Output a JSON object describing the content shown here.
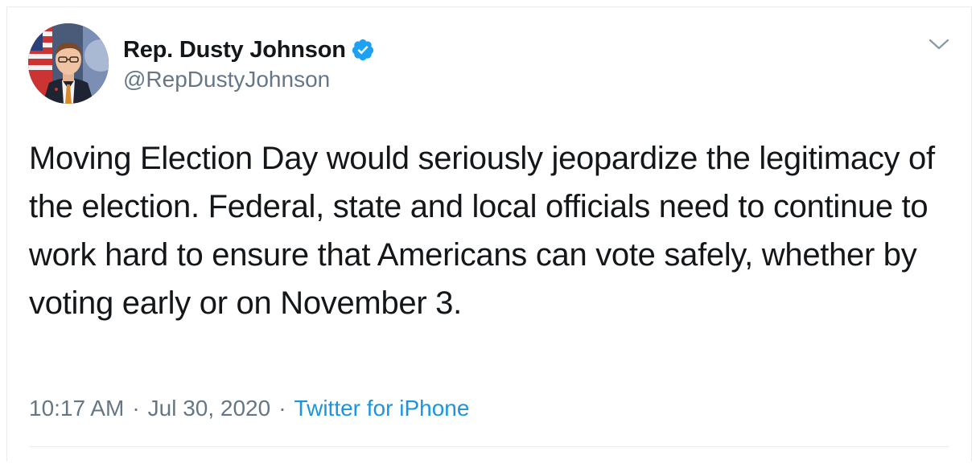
{
  "author": {
    "display_name": "Rep. Dusty Johnson",
    "handle": "@RepDustyJohnson",
    "verified": true
  },
  "tweet": {
    "text": "Moving Election Day would seriously jeopardize the legitimacy of the election. Federal, state and local officials need to continue to work hard to ensure that Americans can vote safely, whether by voting early or on November 3."
  },
  "meta": {
    "time": "10:17 AM",
    "separator": "·",
    "date": "Jul 30, 2020",
    "source": "Twitter for iPhone"
  },
  "icons": {
    "verified": "verified-badge-icon",
    "menu": "chevron-down-icon"
  },
  "colors": {
    "link": "#1b95e0",
    "muted": "#657786",
    "text": "#14171a",
    "verified": "#1da1f2"
  }
}
